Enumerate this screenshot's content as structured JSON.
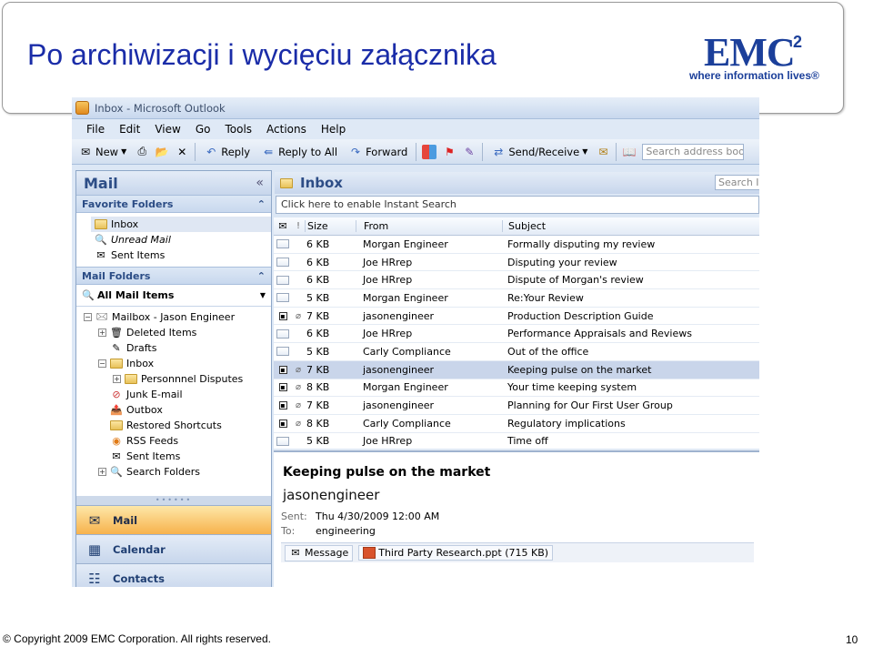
{
  "slide": {
    "title": "Po archiwizacji i wycięciu załącznika",
    "logo_word": "EMC",
    "logo_sup": "2",
    "logo_tagline": "where information lives®",
    "copyright": "© Copyright 2009 EMC Corporation. All rights reserved.",
    "page_number": "10"
  },
  "window": {
    "title": "Inbox - Microsoft Outlook",
    "menu": [
      "File",
      "Edit",
      "View",
      "Go",
      "Tools",
      "Actions",
      "Help"
    ],
    "toolbar": {
      "new": "New",
      "reply": "Reply",
      "reply_all": "Reply to All",
      "forward": "Forward",
      "send_receive": "Send/Receive",
      "address_placeholder": "Search address books"
    }
  },
  "nav": {
    "header": "Mail",
    "favorites_label": "Favorite Folders",
    "favorites": [
      "Inbox",
      "Unread Mail",
      "Sent Items"
    ],
    "mail_folders_label": "Mail Folders",
    "all_mail": "All Mail Items",
    "mailbox": "Mailbox - Jason Engineer",
    "folders": [
      "Deleted Items",
      "Drafts",
      "Inbox",
      "Personnnel Disputes",
      "Junk E-mail",
      "Outbox",
      "Restored Shortcuts",
      "RSS Feeds",
      "Sent Items",
      "Search Folders"
    ],
    "buttons": [
      "Mail",
      "Calendar",
      "Contacts"
    ]
  },
  "inbox": {
    "title": "Inbox",
    "search_placeholder": "Search Inbox",
    "instant_search": "Click here to enable Instant Search",
    "columns": {
      "size": "Size",
      "from": "From",
      "subject": "Subject"
    },
    "rows": [
      {
        "size": "6 KB",
        "from": "Morgan Engineer",
        "subject": "Formally disputing my review",
        "att": false,
        "selected": false
      },
      {
        "size": "6 KB",
        "from": "Joe HRrep",
        "subject": "Disputing your review",
        "att": false,
        "selected": false
      },
      {
        "size": "6 KB",
        "from": "Joe HRrep",
        "subject": "Dispute of Morgan's review",
        "att": false,
        "selected": false
      },
      {
        "size": "5 KB",
        "from": "Morgan Engineer",
        "subject": "Re:Your Review",
        "att": false,
        "selected": false
      },
      {
        "size": "7 KB",
        "from": "jasonengineer",
        "subject": "Production Description Guide",
        "att": true,
        "selected": false
      },
      {
        "size": "6 KB",
        "from": "Joe HRrep",
        "subject": "Performance Appraisals and Reviews",
        "att": false,
        "selected": false
      },
      {
        "size": "5 KB",
        "from": "Carly Compliance",
        "subject": "Out of the office",
        "att": false,
        "selected": false
      },
      {
        "size": "7 KB",
        "from": "jasonengineer",
        "subject": "Keeping pulse on the market",
        "att": true,
        "selected": true
      },
      {
        "size": "8 KB",
        "from": "Morgan Engineer",
        "subject": "Your time keeping system",
        "att": true,
        "selected": false
      },
      {
        "size": "7 KB",
        "from": "jasonengineer",
        "subject": "Planning for Our First User Group",
        "att": true,
        "selected": false
      },
      {
        "size": "8 KB",
        "from": "Carly Compliance",
        "subject": "Regulatory implications",
        "att": true,
        "selected": false
      },
      {
        "size": "5 KB",
        "from": "Joe HRrep",
        "subject": "Time off",
        "att": false,
        "selected": false
      }
    ]
  },
  "reading": {
    "subject": "Keeping pulse on the market",
    "from": "jasonengineer",
    "sent_label": "Sent:",
    "sent": "Thu 4/30/2009 12:00 AM",
    "to_label": "To:",
    "to": "engineering",
    "message_tab": "Message",
    "attachment": "Third Party Research.ppt (715 KB)"
  },
  "colors": {
    "title_blue": "#1a2ca8",
    "emc_blue": "#1b3f9a",
    "selected_row": "#c9d5ea",
    "active_nav": "#f7b24c"
  }
}
